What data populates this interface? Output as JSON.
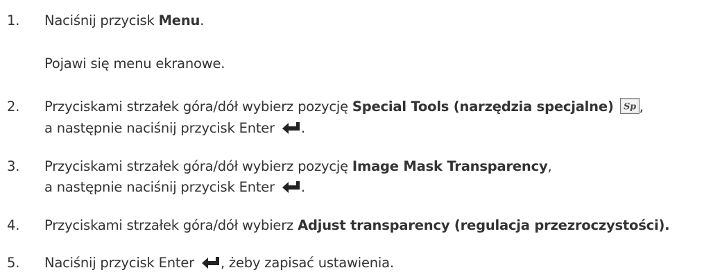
{
  "steps": [
    {
      "number": "1.",
      "before": "Naciśnij przycisk ",
      "bold": "Menu",
      "after": "."
    },
    {
      "result": "Pojawi się menu ekranowe."
    },
    {
      "number": "2.",
      "before": "Przyciskami strzałek góra/dół wybierz pozycję ",
      "bold": "Special Tools (narzędzia specjalne)",
      "after": ",",
      "line2_before": "a następnie naciśnij przycisk Enter ",
      "line2_after": ".",
      "icon_label": "Sp"
    },
    {
      "number": "3.",
      "before": "Przyciskami strzałek góra/dół wybierz pozycję ",
      "bold": "Image Mask Transparency",
      "after": ",",
      "line2_before": "a następnie naciśnij przycisk Enter ",
      "line2_after": "."
    },
    {
      "number": "4.",
      "before": "Przyciskami strzałek góra/dół wybierz ",
      "bold": "Adjust transparency (regulacja przezroczystości)."
    },
    {
      "number": "5.",
      "before": "Naciśnij przycisk Enter ",
      "after": ", żeby zapisać ustawienia."
    }
  ],
  "icons": {
    "enter": "enter-arrow-icon",
    "special_tools": "special-tools-icon"
  },
  "colors": {
    "text": "#333333",
    "background": "#ffffff"
  }
}
